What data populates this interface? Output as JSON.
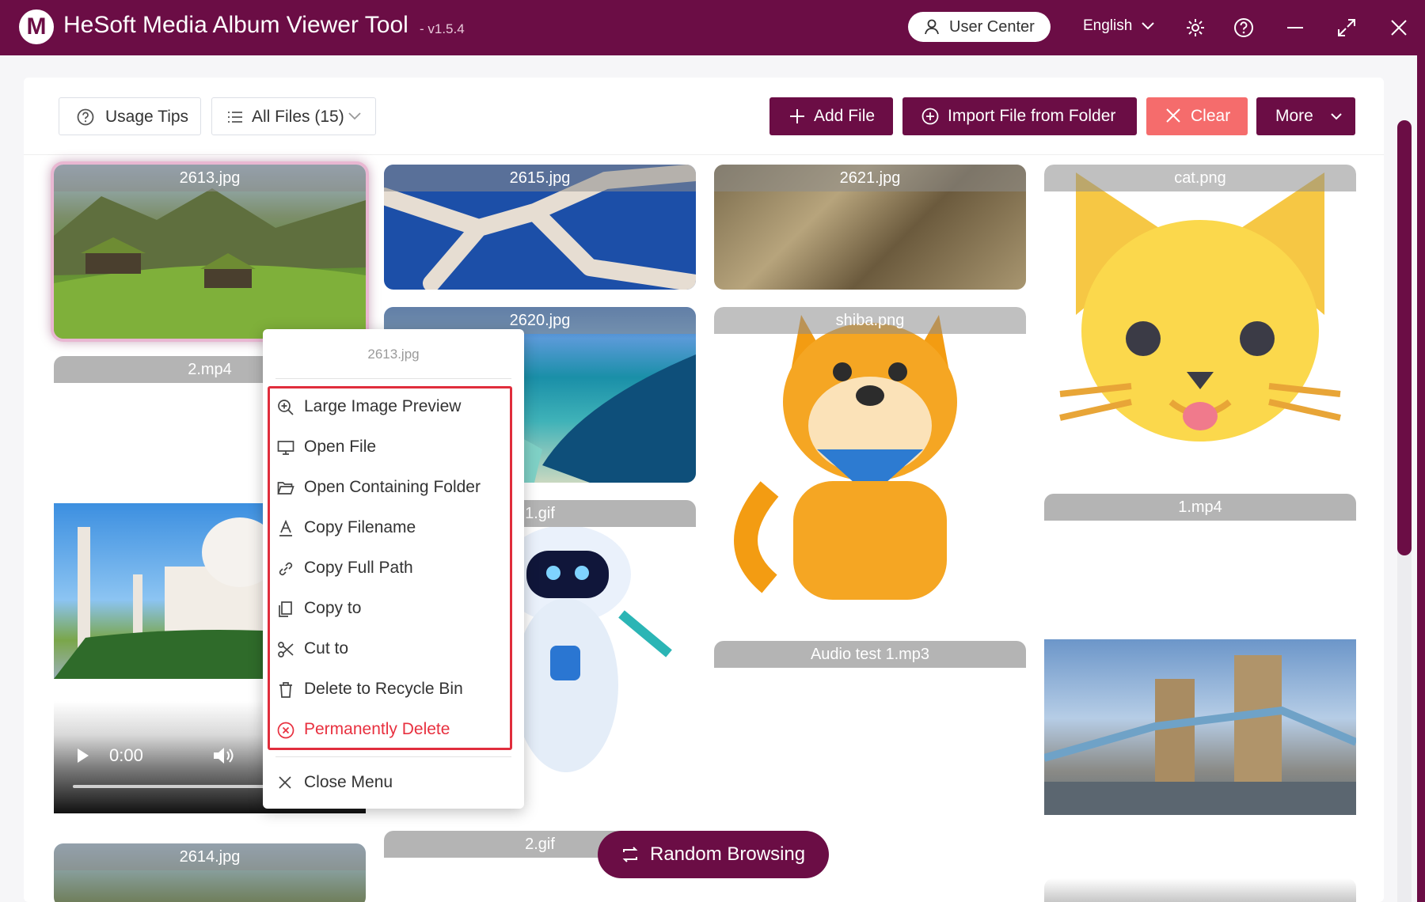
{
  "app": {
    "title": "HeSoft Media Album Viewer Tool",
    "version": "- v1.5.4",
    "logo_letter": "M"
  },
  "titlebar": {
    "user_center": "User Center",
    "language": "English"
  },
  "toolbar": {
    "usage_tips": "Usage Tips",
    "all_files": "All Files (15)",
    "add_file": "Add File",
    "import_folder": "Import File from Folder",
    "clear": "Clear",
    "more": "More"
  },
  "tiles": {
    "t2613": "2613.jpg",
    "t2615": "2615.jpg",
    "t2621": "2621.jpg",
    "cat": "cat.png",
    "t2620": "2620.jpg",
    "shiba": "shiba.png",
    "mp4_2": "2.mp4",
    "gif_1": "1.gif",
    "mp4_1": "1.mp4",
    "audio": "Audio test 1.mp3",
    "t2614": "2614.jpg",
    "gif_2": "2.gif"
  },
  "video": {
    "time": "0:00"
  },
  "context_menu": {
    "title": "2613.jpg",
    "items": [
      "Large Image Preview",
      "Open File",
      "Open Containing Folder",
      "Copy Filename",
      "Copy Full Path",
      "Copy to",
      "Cut to",
      "Delete to Recycle Bin",
      "Permanently Delete"
    ],
    "close": "Close Menu"
  },
  "random_browsing": "Random Browsing",
  "colors": {
    "brand": "#6b0d45",
    "danger": "#f56c6c",
    "menu_highlight": "#e02d3c"
  }
}
